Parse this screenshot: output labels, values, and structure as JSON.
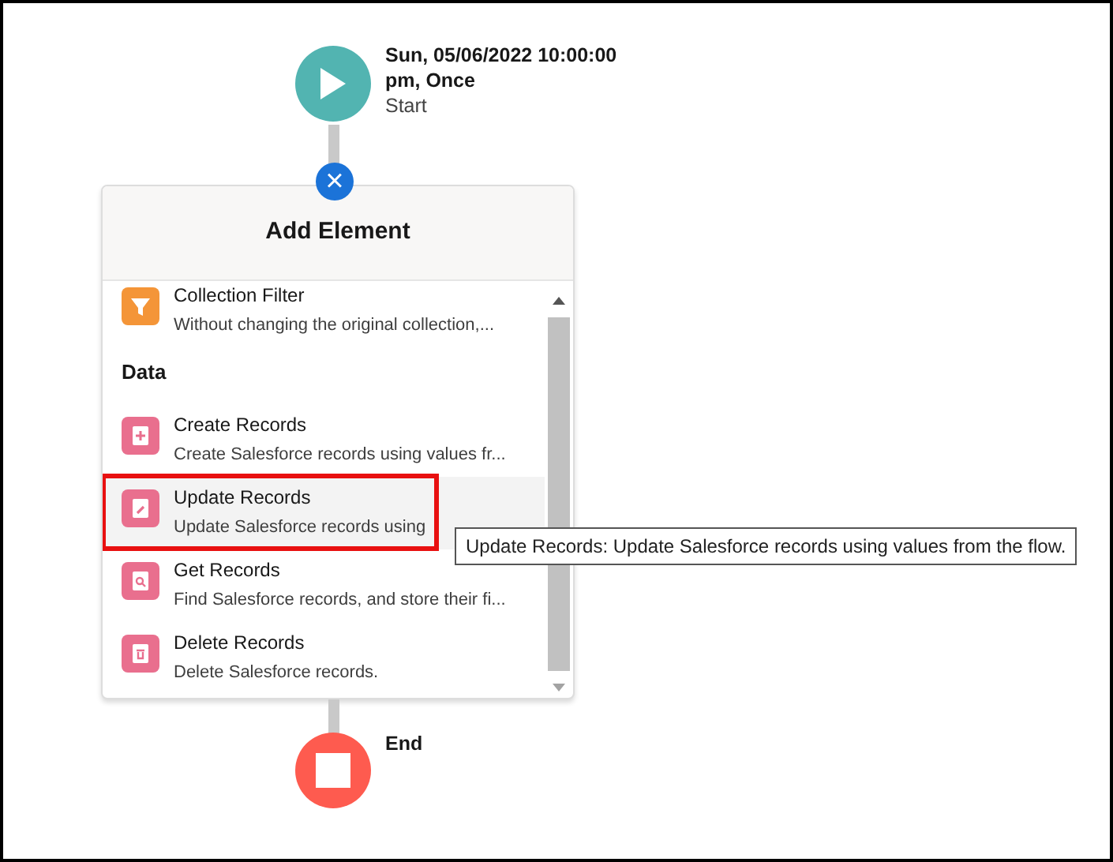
{
  "start_node": {
    "title": "Sun, 05/06/2022 10:00:00 pm, Once",
    "subtitle": "Start"
  },
  "close_button": {
    "label": "×"
  },
  "panel": {
    "title": "Add Element",
    "sections": [
      {
        "kind": "item",
        "title": "Collection Filter",
        "description": "Without changing the original collection,...",
        "selected": false,
        "outlined": false
      },
      {
        "kind": "heading",
        "title": "Data"
      },
      {
        "kind": "item",
        "title": "Create Records",
        "description": "Create Salesforce records using values fr...",
        "selected": false,
        "outlined": false
      },
      {
        "kind": "item",
        "title": "Update Records",
        "description": "Update Salesforce records using",
        "selected": true,
        "outlined": true
      },
      {
        "kind": "item",
        "title": "Get Records",
        "description": "Find Salesforce records, and store their fi...",
        "selected": false,
        "outlined": false
      },
      {
        "kind": "item",
        "title": "Delete Records",
        "description": "Delete Salesforce records.",
        "selected": false,
        "outlined": false
      }
    ]
  },
  "tooltip": {
    "text": "Update Records: Update Salesforce records using values from the flow."
  },
  "end_node": {
    "title": "End"
  }
}
